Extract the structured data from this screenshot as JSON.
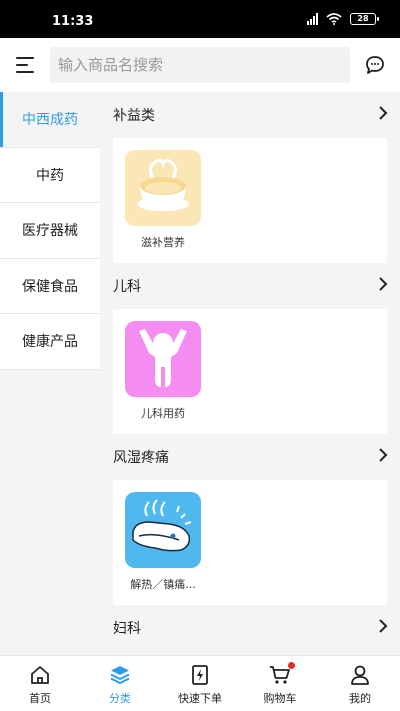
{
  "status_bar": {
    "time": "11:33",
    "battery": "28"
  },
  "search": {
    "placeholder": "输入商品名搜索"
  },
  "sidebar": {
    "items": [
      {
        "label": "中西成药",
        "active": true
      },
      {
        "label": "中药"
      },
      {
        "label": "医疗器械"
      },
      {
        "label": "保健食品"
      },
      {
        "label": "健康产品"
      }
    ]
  },
  "sections": [
    {
      "title": "补益类",
      "product": {
        "label": "滋补营养",
        "icon": "tonic-bowl-icon",
        "color": "#fbe7b5"
      }
    },
    {
      "title": "儿科",
      "product": {
        "label": "儿科用药",
        "icon": "child-figure-icon",
        "color": "#f58cf2"
      }
    },
    {
      "title": "风湿疼痛",
      "product": {
        "label": "解热／镇痛...",
        "icon": "pain-relief-icon",
        "color": "#4fb8ef"
      }
    },
    {
      "title": "妇科"
    }
  ],
  "bottom_nav": {
    "items": [
      {
        "label": "首页",
        "icon": "home-icon"
      },
      {
        "label": "分类",
        "icon": "category-layers-icon",
        "active": true
      },
      {
        "label": "快速下单",
        "icon": "quick-order-icon"
      },
      {
        "label": "购物车",
        "icon": "cart-icon"
      },
      {
        "label": "我的",
        "icon": "profile-icon"
      }
    ]
  },
  "colors": {
    "accent": "#2f9ce8",
    "badge": "#e42a2a"
  }
}
